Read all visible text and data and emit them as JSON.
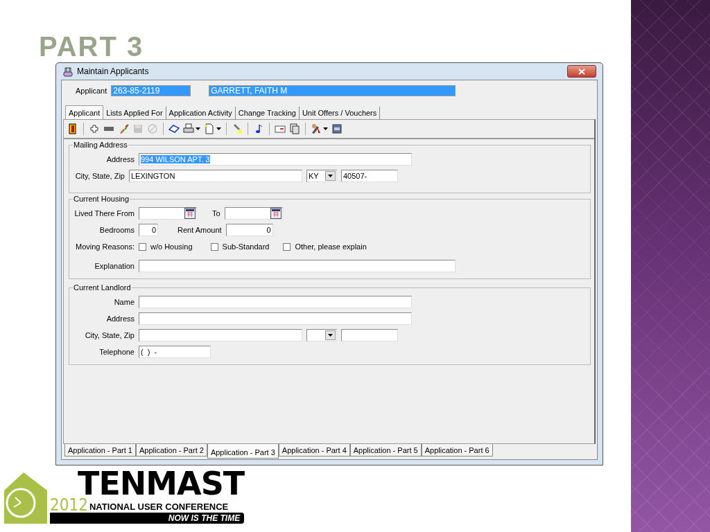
{
  "slide": {
    "title": "PART 3"
  },
  "window": {
    "title": "Maintain Applicants"
  },
  "applicant": {
    "label": "Applicant",
    "id": "263-85-2119",
    "name": "GARRETT, FAITH M"
  },
  "tabs": [
    {
      "label": "Applicant",
      "selected": true
    },
    {
      "label": "Lists Applied For",
      "selected": false
    },
    {
      "label": "Application Activity",
      "selected": false
    },
    {
      "label": "Change Tracking",
      "selected": false
    },
    {
      "label": "Unit Offers / Vouchers",
      "selected": false
    }
  ],
  "toolbar": [
    {
      "kind": "button",
      "disabled": false,
      "dropdown": false
    },
    {
      "kind": "separator"
    },
    {
      "kind": "button",
      "disabled": false,
      "dropdown": false
    },
    {
      "kind": "button",
      "disabled": false,
      "dropdown": false
    },
    {
      "kind": "button",
      "disabled": false,
      "dropdown": false
    },
    {
      "kind": "button",
      "disabled": true,
      "dropdown": false
    },
    {
      "kind": "button",
      "disabled": true,
      "dropdown": false
    },
    {
      "kind": "separator"
    },
    {
      "kind": "button",
      "disabled": false,
      "dropdown": false
    },
    {
      "kind": "button",
      "disabled": false,
      "dropdown": true
    },
    {
      "kind": "button",
      "disabled": false,
      "dropdown": true
    },
    {
      "kind": "separator"
    },
    {
      "kind": "button",
      "disabled": false,
      "dropdown": false
    },
    {
      "kind": "separator"
    },
    {
      "kind": "button",
      "disabled": false,
      "dropdown": false
    },
    {
      "kind": "separator"
    },
    {
      "kind": "button",
      "disabled": false,
      "dropdown": false
    },
    {
      "kind": "button",
      "disabled": false,
      "dropdown": false
    },
    {
      "kind": "separator"
    },
    {
      "kind": "button",
      "disabled": false,
      "dropdown": true
    },
    {
      "kind": "button",
      "disabled": false,
      "dropdown": false
    }
  ],
  "mailing_address": {
    "legend": "Mailing Address",
    "address_label": "Address",
    "address": "994 WILSON APT. 3",
    "address_selected": true,
    "city_label": "City, State, Zip",
    "city": "LEXINGTON",
    "state": "KY",
    "zip": "40507-"
  },
  "current_housing": {
    "legend": "Current Housing",
    "from_label": "Lived There From",
    "to_label": "To",
    "bedrooms_label": "Bedrooms",
    "bedrooms": "0",
    "rent_label": "Rent Amount",
    "rent": "0",
    "reasons_label": "Moving Reasons:",
    "reasons": [
      {
        "label": "w/o Housing",
        "checked": false
      },
      {
        "label": "Sub-Standard",
        "checked": false
      },
      {
        "label": "Other, please explain",
        "checked": false
      }
    ],
    "explanation_label": "Explanation"
  },
  "current_landlord": {
    "legend": "Current Landlord",
    "name_label": "Name",
    "address_label": "Address",
    "city_label": "City, State, Zip",
    "telephone_label": "Telephone",
    "telephone": "(  )  -"
  },
  "bottom_tabs": [
    {
      "label": "Application - Part 1",
      "selected": false
    },
    {
      "label": "Application - Part 2",
      "selected": false
    },
    {
      "label": "Application - Part 3",
      "selected": true
    },
    {
      "label": "Application - Part 4",
      "selected": false
    },
    {
      "label": "Application - Part 5",
      "selected": false
    },
    {
      "label": "Application - Part 6",
      "selected": false
    }
  ],
  "logo": {
    "brand": "TENMAST",
    "year": "2012",
    "subtitle": "NATIONAL USER CONFERENCE",
    "tagline": "NOW IS THE TIME"
  }
}
